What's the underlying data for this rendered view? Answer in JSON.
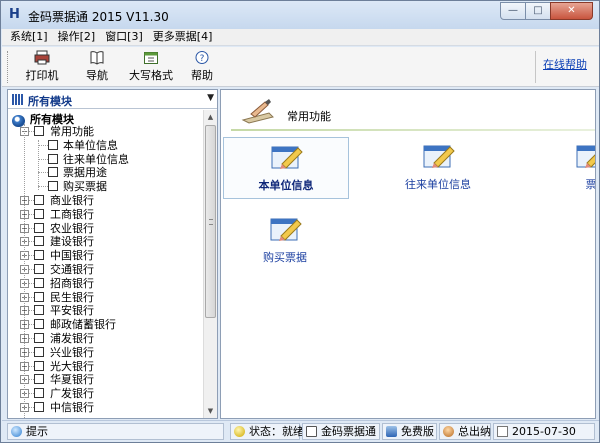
{
  "window": {
    "title": "金码票据通 2015   V11.30",
    "app_icon": "H",
    "buttons": {
      "minimize": "—",
      "maximize": "□",
      "close": "✕"
    }
  },
  "menu": [
    "系统[1]",
    "操作[2]",
    "窗口[3]",
    "更多票据[4]"
  ],
  "toolbar": {
    "buttons": [
      {
        "label": "打印机",
        "icon": "printer-icon"
      },
      {
        "label": "导航",
        "icon": "book-icon"
      },
      {
        "label": "大写格式",
        "icon": "calendar-icon"
      },
      {
        "label": "帮助",
        "icon": "help-icon"
      }
    ],
    "online_help": "在线帮助"
  },
  "sidebar": {
    "combo_label": "所有模块",
    "tree_root": "所有模块",
    "tree": [
      {
        "label": "常用功能",
        "level": 1,
        "expanded": true
      },
      {
        "label": "本单位信息",
        "level": 2
      },
      {
        "label": "往来单位信息",
        "level": 2
      },
      {
        "label": "票据用途",
        "level": 2
      },
      {
        "label": "购买票据",
        "level": 2
      },
      {
        "label": "商业银行",
        "level": 1
      },
      {
        "label": "工商银行",
        "level": 1
      },
      {
        "label": "农业银行",
        "level": 1
      },
      {
        "label": "建设银行",
        "level": 1
      },
      {
        "label": "中国银行",
        "level": 1
      },
      {
        "label": "交通银行",
        "level": 1
      },
      {
        "label": "招商银行",
        "level": 1
      },
      {
        "label": "民生银行",
        "level": 1
      },
      {
        "label": "平安银行",
        "level": 1
      },
      {
        "label": "邮政储蓄银行",
        "level": 1
      },
      {
        "label": "浦发银行",
        "level": 1
      },
      {
        "label": "兴业银行",
        "level": 1
      },
      {
        "label": "光大银行",
        "level": 1
      },
      {
        "label": "华夏银行",
        "level": 1
      },
      {
        "label": "广发银行",
        "level": 1
      },
      {
        "label": "中信银行",
        "level": 1
      }
    ]
  },
  "main": {
    "section_title": "常用功能",
    "functions": [
      {
        "label": "本单位信息",
        "selected": true
      },
      {
        "label": "往来单位信息",
        "selected": false
      },
      {
        "label": "票据用途",
        "visible_text": "票",
        "selected": false
      },
      {
        "label": "购买票据",
        "selected": false
      }
    ]
  },
  "statusbar": {
    "hint": "提示",
    "status": "状态：就绪",
    "app_name": "金码票据通",
    "edition": "免费版",
    "total": "总出纳",
    "date": "2015-07-30"
  },
  "colors": {
    "accent": "#1b3fa0",
    "frame": "#dfe9f5",
    "link": "#0b3fb5"
  }
}
